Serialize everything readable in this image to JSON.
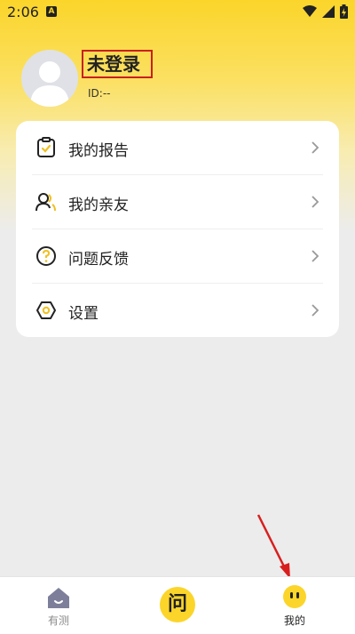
{
  "status_bar": {
    "time": "2:06",
    "notification_letter": "A"
  },
  "profile": {
    "name": "未登录",
    "id_text": "ID:--"
  },
  "menu": [
    {
      "label": "我的报告",
      "icon": "report-clipboard-icon"
    },
    {
      "label": "我的亲友",
      "icon": "friends-icon"
    },
    {
      "label": "问题反馈",
      "icon": "question-circle-icon"
    },
    {
      "label": "设置",
      "icon": "settings-gear-icon"
    }
  ],
  "bottom_nav": {
    "tab1": {
      "label": "有测",
      "icon": "home-house-icon"
    },
    "center": {
      "label": "问",
      "icon": "ask-bubble-icon"
    },
    "tab3": {
      "label": "我的",
      "icon": "mine-face-icon"
    }
  },
  "colors": {
    "accent": "#fbd52a",
    "highlight_border": "#c8201a",
    "arrow": "#d81f1f"
  }
}
